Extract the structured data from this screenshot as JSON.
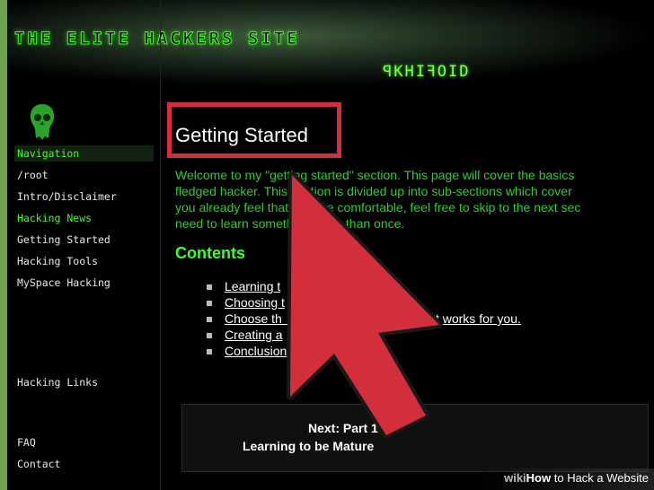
{
  "banner": {
    "site_title": "THE ELITE HACKERS SITE",
    "logo_text": "ꟼKHIꟻOID"
  },
  "nav": {
    "items": [
      {
        "label": "Navigation",
        "style": "header"
      },
      {
        "label": "/root",
        "style": "white"
      },
      {
        "label": "Intro/Disclaimer",
        "style": "white"
      },
      {
        "label": "Hacking News",
        "style": "green"
      },
      {
        "label": "Getting Started",
        "style": "white"
      },
      {
        "label": "Hacking Tools",
        "style": "white"
      },
      {
        "label": "MySpace Hacking",
        "style": "white"
      },
      {
        "label": "Hacking Links",
        "style": "white"
      },
      {
        "label": "FAQ",
        "style": "white"
      },
      {
        "label": "Contact",
        "style": "white"
      }
    ]
  },
  "main": {
    "heading": "Getting Started",
    "intro_lines": [
      "Welcome to my \"getting started\" section. This page will cover the basics",
      "fledged hacker. This section is divided up into sub-sections which cover",
      "you already feel that you are comfortable, feel free to skip to the next sec",
      "need to learn something more than once."
    ],
    "contents_title": "Contents",
    "contents_items": [
      "Learning t",
      "Choosing t",
      "Choose th                                          nt works for you.",
      "Creating a",
      "Conclusion"
    ],
    "next_line1": "Next: Part 1",
    "next_line2": "Learning to be Mature"
  },
  "watermark": {
    "wiki": "wiki",
    "how": "How",
    "rest": " to Hack a Website"
  },
  "colors": {
    "accent_green": "#3cff2a",
    "text_green": "#2ecc2e",
    "arrow_red": "#d32e3c",
    "frame_green": "#6fa34f"
  }
}
